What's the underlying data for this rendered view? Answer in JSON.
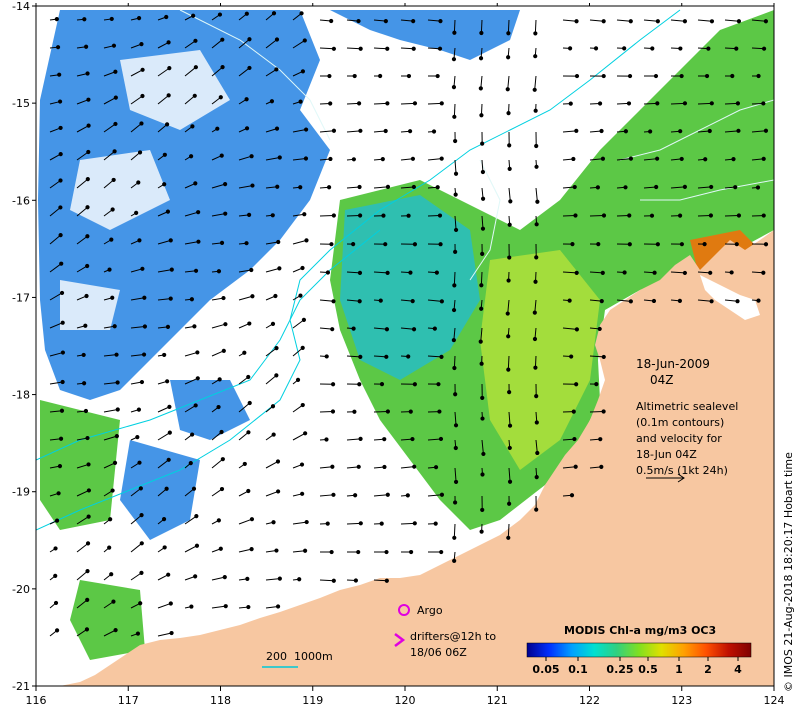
{
  "map": {
    "lon_ticks": [
      "116",
      "117",
      "118",
      "119",
      "120",
      "121",
      "122",
      "123",
      "124"
    ],
    "lat_ticks": [
      "-14",
      "-15",
      "-16",
      "-17",
      "-18",
      "-19",
      "-20",
      "-21"
    ],
    "lon_range": [
      116,
      124
    ],
    "lat_range": [
      -21,
      -14
    ]
  },
  "annotations": {
    "date": "18-Jun-2009",
    "time": "04Z",
    "altimetry_line1": "Altimetric sealevel",
    "altimetry_line2": "(0.1m contours)",
    "altimetry_line3": "and velocity for",
    "altimetry_line4": "18-Jun 04Z",
    "scale_arrow": "0.5m/s (1kt 24h)",
    "argo": "Argo",
    "drifters_line1": "drifters@12h to",
    "drifters_line2": "18/06 06Z",
    "bathymetry": "200  1000m",
    "credit": "© IMOS 21-Aug-2018 18:20:17 Hobart time"
  },
  "colorbar": {
    "title": "MODIS Chl-a mg/m3 OC3",
    "labels": [
      "0.05",
      "0.1",
      "0.25",
      "0.5",
      "1",
      "2",
      "4"
    ],
    "colors": [
      "#00008f",
      "#0030ff",
      "#00a0ff",
      "#00e0d0",
      "#30d080",
      "#80e020",
      "#e0e000",
      "#ffa000",
      "#ff5000",
      "#c01000",
      "#800000"
    ]
  },
  "colors": {
    "land": "#f7c7a1",
    "ocean_blue": "#3b8fe6",
    "ocean_teal": "#2fbfb0",
    "ocean_green": "#5cc846",
    "ocean_yellow": "#b5e23a",
    "contour_cyan": "#00d0e0",
    "argo_marker": "#e000e0"
  }
}
